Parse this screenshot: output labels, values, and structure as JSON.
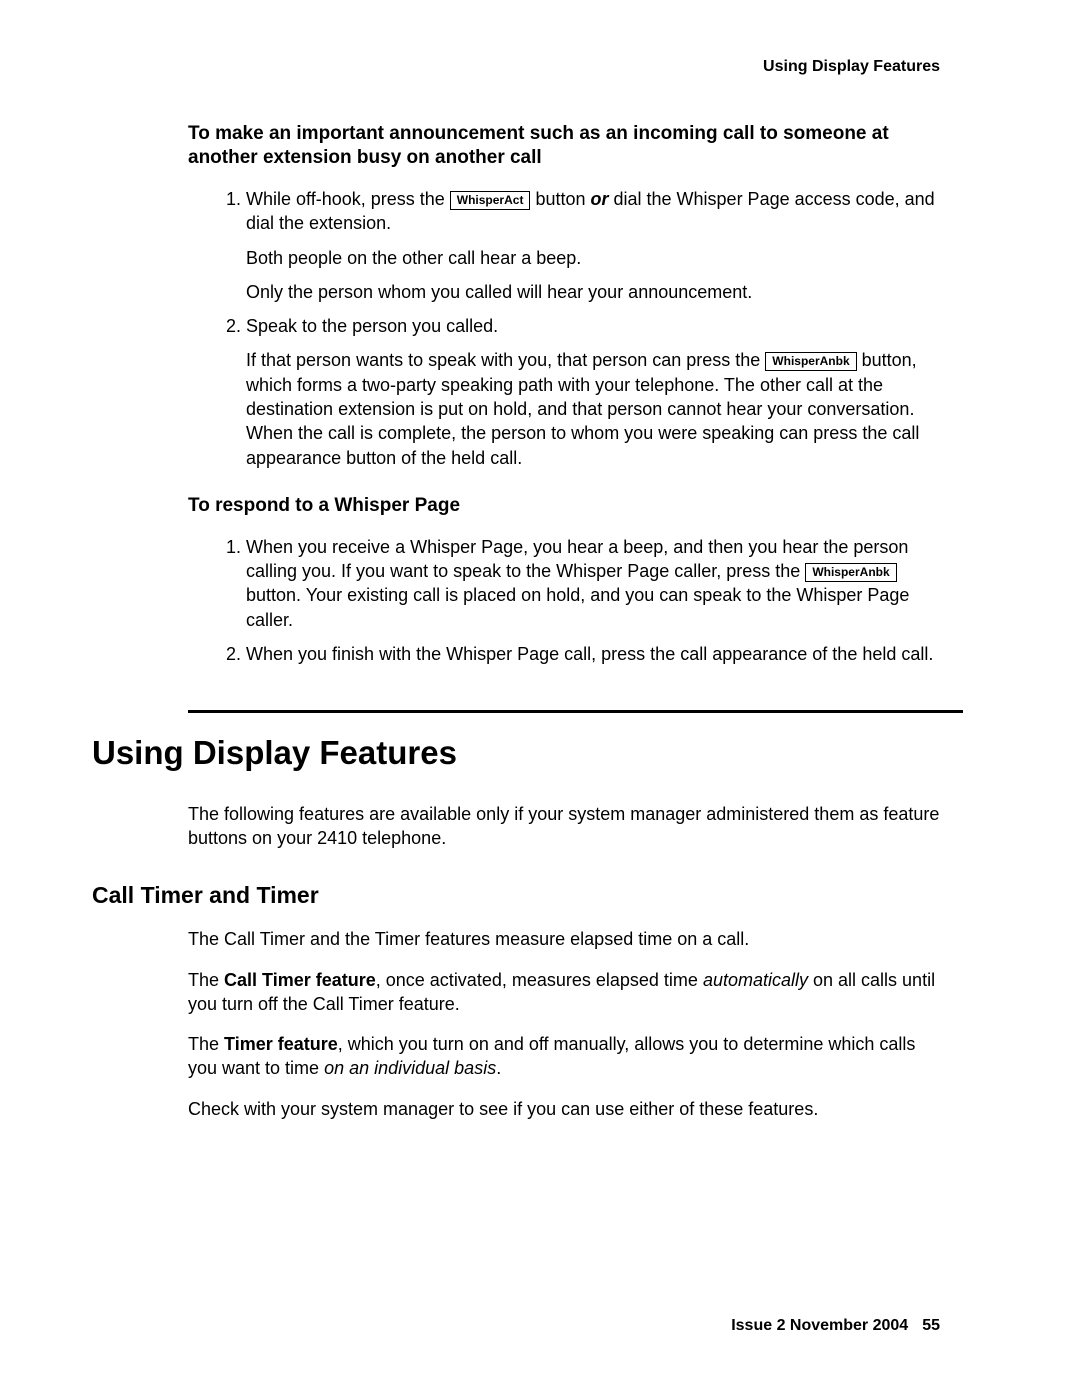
{
  "header": {
    "running": "Using Display Features"
  },
  "section1": {
    "title": "To make an important announcement such as an incoming call to someone at another extension busy on another call",
    "step1_a": "While off-hook, press the ",
    "step1_btn": "WhisperAct",
    "step1_b": " button ",
    "step1_or": "or",
    "step1_c": " dial the Whisper Page access code, and dial the extension.",
    "step1_p2": "Both people on the other call hear a beep.",
    "step1_p3": "Only the person whom you called will hear your announcement.",
    "step2_a": "Speak to the person you called.",
    "step2_p2_a": "If that person wants to speak with you, that person can press the ",
    "step2_btn": "WhisperAnbk",
    "step2_p2_b": " button, which forms a two-party speaking path with your telephone. The other call at the destination extension is put on hold, and that person cannot hear your conversation. When the call is complete, the person to whom you were speaking can press the call appearance button of the held call."
  },
  "section2": {
    "title": "To respond to a Whisper Page",
    "step1_a": "When you receive a Whisper Page, you hear a beep, and then you hear the person calling you. If you want to speak to the Whisper Page caller, press the ",
    "step1_btn": "WhisperAnbk",
    "step1_b": " button. Your existing call is placed on hold, and you can speak to the Whisper Page caller.",
    "step2": "When you finish with the Whisper Page call, press the call appearance of the held call."
  },
  "chapter": {
    "title": "Using Display Features",
    "intro": "The following features are available only if your system manager administered them as feature buttons on your 2410 telephone."
  },
  "subsection": {
    "title": "Call Timer and Timer",
    "p1": "The Call Timer and the Timer features measure elapsed time on a call.",
    "p2_a": "The ",
    "p2_b": "Call Timer feature",
    "p2_c": ", once activated, measures elapsed time ",
    "p2_d": "automatically",
    "p2_e": " on all calls until you turn off the Call Timer feature.",
    "p3_a": "The ",
    "p3_b": "Timer feature",
    "p3_c": ", which you turn on and off manually, allows you to determine which calls you want to time ",
    "p3_d": "on an individual basis",
    "p3_e": ".",
    "p4": "Check with your system manager to see if you can use either of these features."
  },
  "footer": {
    "issue": "Issue 2   November 2004",
    "page": "55"
  }
}
